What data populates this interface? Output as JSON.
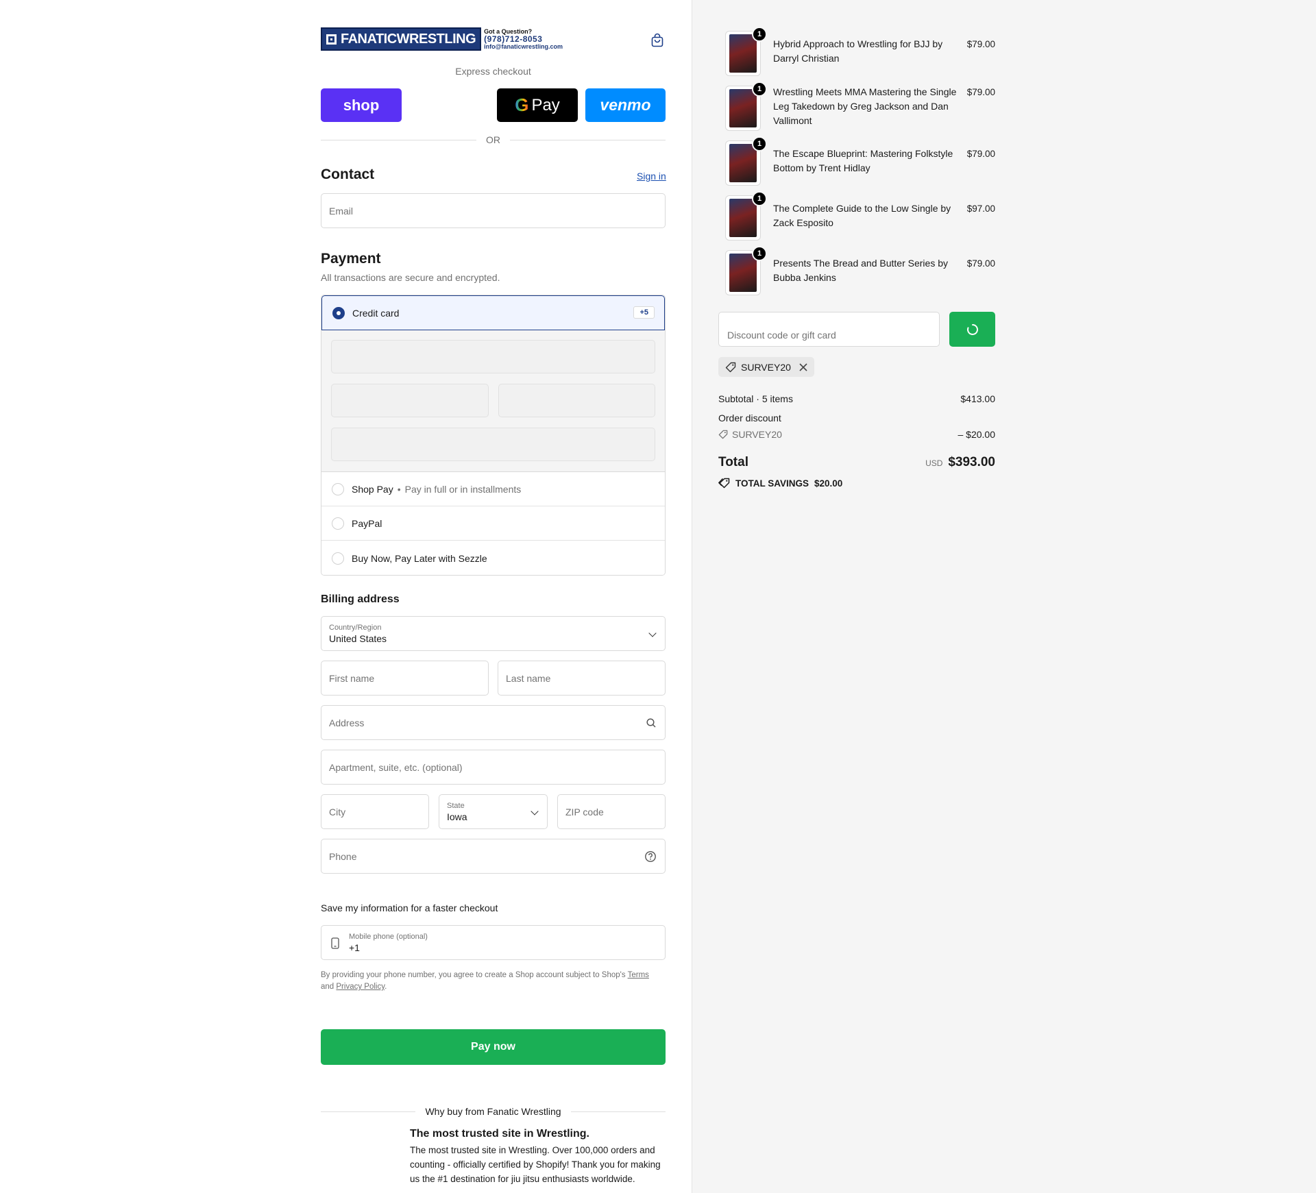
{
  "header": {
    "logo_text": "FANATICWRESTLING",
    "question": "Got a Question?",
    "phone": "(978)712-8053",
    "email": "info@fanaticwrestling.com"
  },
  "express": {
    "label": "Express checkout",
    "shop_label": "shop",
    "gpay_label": "Pay",
    "venmo_label": "venmo",
    "or_label": "OR"
  },
  "contact": {
    "heading": "Contact",
    "sign_in": "Sign in",
    "email_placeholder": "Email"
  },
  "payment": {
    "heading": "Payment",
    "subtitle": "All transactions are secure and encrypted.",
    "credit_card": "Credit card",
    "more_badge": "+5",
    "shop_pay": "Shop Pay",
    "shop_pay_note": "Pay in full or in installments",
    "paypal": "PayPal",
    "sezzle": "Buy Now, Pay Later with Sezzle"
  },
  "billing": {
    "heading": "Billing address",
    "country_label": "Country/Region",
    "country_value": "United States",
    "first_name": "First name",
    "last_name": "Last name",
    "address": "Address",
    "apartment": "Apartment, suite, etc. (optional)",
    "city": "City",
    "state_label": "State",
    "state_value": "Iowa",
    "zip": "ZIP code",
    "phone": "Phone"
  },
  "save_info": {
    "heading": "Save my information for a faster checkout",
    "mobile_label": "Mobile phone (optional)",
    "mobile_value": "+1",
    "note_prefix": "By providing your phone number, you agree to create a Shop account subject to Shop's",
    "terms": "Terms",
    "and": "and",
    "privacy": "Privacy Policy"
  },
  "pay_now": "Pay now",
  "why": {
    "label": "Why buy from Fanatic Wrestling",
    "title": "The most trusted site in Wrestling.",
    "description": "The most trusted site in Wrestling. Over 100,000 orders and counting - officially certified by Shopify! Thank you for making us the #1 destination for jiu jitsu enthusiasts worldwide."
  },
  "cart": {
    "items": [
      {
        "name": "Hybrid Approach to Wrestling for BJJ by Darryl Christian",
        "price": "$79.00",
        "qty": "1"
      },
      {
        "name": "Wrestling Meets MMA Mastering the Single Leg Takedown by Greg Jackson and Dan Vallimont",
        "price": "$79.00",
        "qty": "1"
      },
      {
        "name": "The Escape Blueprint: Mastering Folkstyle Bottom by Trent Hidlay",
        "price": "$79.00",
        "qty": "1"
      },
      {
        "name": "The Complete Guide to the Low Single by Zack Esposito",
        "price": "$97.00",
        "qty": "1"
      },
      {
        "name": "Presents The Bread and Butter Series by Bubba Jenkins",
        "price": "$79.00",
        "qty": "1"
      }
    ],
    "discount_placeholder": "Discount code or gift card",
    "applied_code": "SURVEY20",
    "subtotal_label": "Subtotal · 5 items",
    "subtotal_value": "$413.00",
    "order_discount_label": "Order discount",
    "discount_code": "SURVEY20",
    "discount_value": "– $20.00",
    "total_label": "Total",
    "currency": "USD",
    "total_value": "$393.00",
    "savings_label": "TOTAL SAVINGS",
    "savings_value": "$20.00"
  },
  "colors": {
    "accent_green": "#1aaf55",
    "shop_purple": "#5a31f4",
    "venmo_blue": "#008cff",
    "selected_navy": "#1e3f8a"
  }
}
